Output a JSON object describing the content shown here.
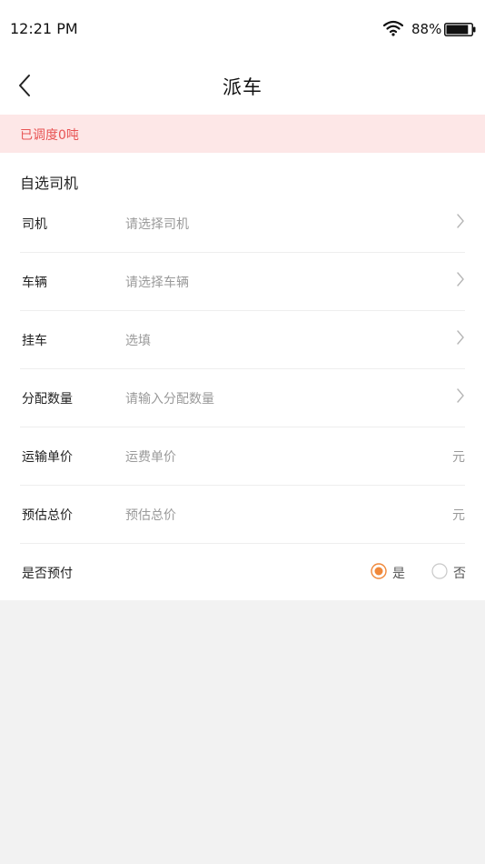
{
  "status_bar": {
    "time": "12:21 PM",
    "battery_percent": "88%",
    "battery_level": 0.88,
    "icons": [
      "wifi-icon",
      "battery-icon"
    ]
  },
  "nav": {
    "title": "派车",
    "back_icon": "chevron-left-icon"
  },
  "banner": {
    "text": "已调度0吨",
    "color": "#e85454",
    "background": "#fde7e7"
  },
  "section": {
    "title": "自选司机"
  },
  "form": {
    "driver": {
      "label": "司机",
      "placeholder": "请选择司机"
    },
    "vehicle": {
      "label": "车辆",
      "placeholder": "请选择车辆"
    },
    "trailer": {
      "label": "挂车",
      "placeholder": "选填"
    },
    "quantity": {
      "label": "分配数量",
      "placeholder": "请输入分配数量"
    },
    "unit_price": {
      "label": "运输单价",
      "placeholder": "运费单价",
      "unit": "元"
    },
    "total_price": {
      "label": "预估总价",
      "placeholder": "预估总价",
      "unit": "元"
    },
    "prepay": {
      "label": "是否预付",
      "options": [
        {
          "label": "是",
          "selected": true
        },
        {
          "label": "否",
          "selected": false
        }
      ]
    }
  },
  "colors": {
    "accent": "#f0883a",
    "page_background": "#f2f2f2"
  }
}
